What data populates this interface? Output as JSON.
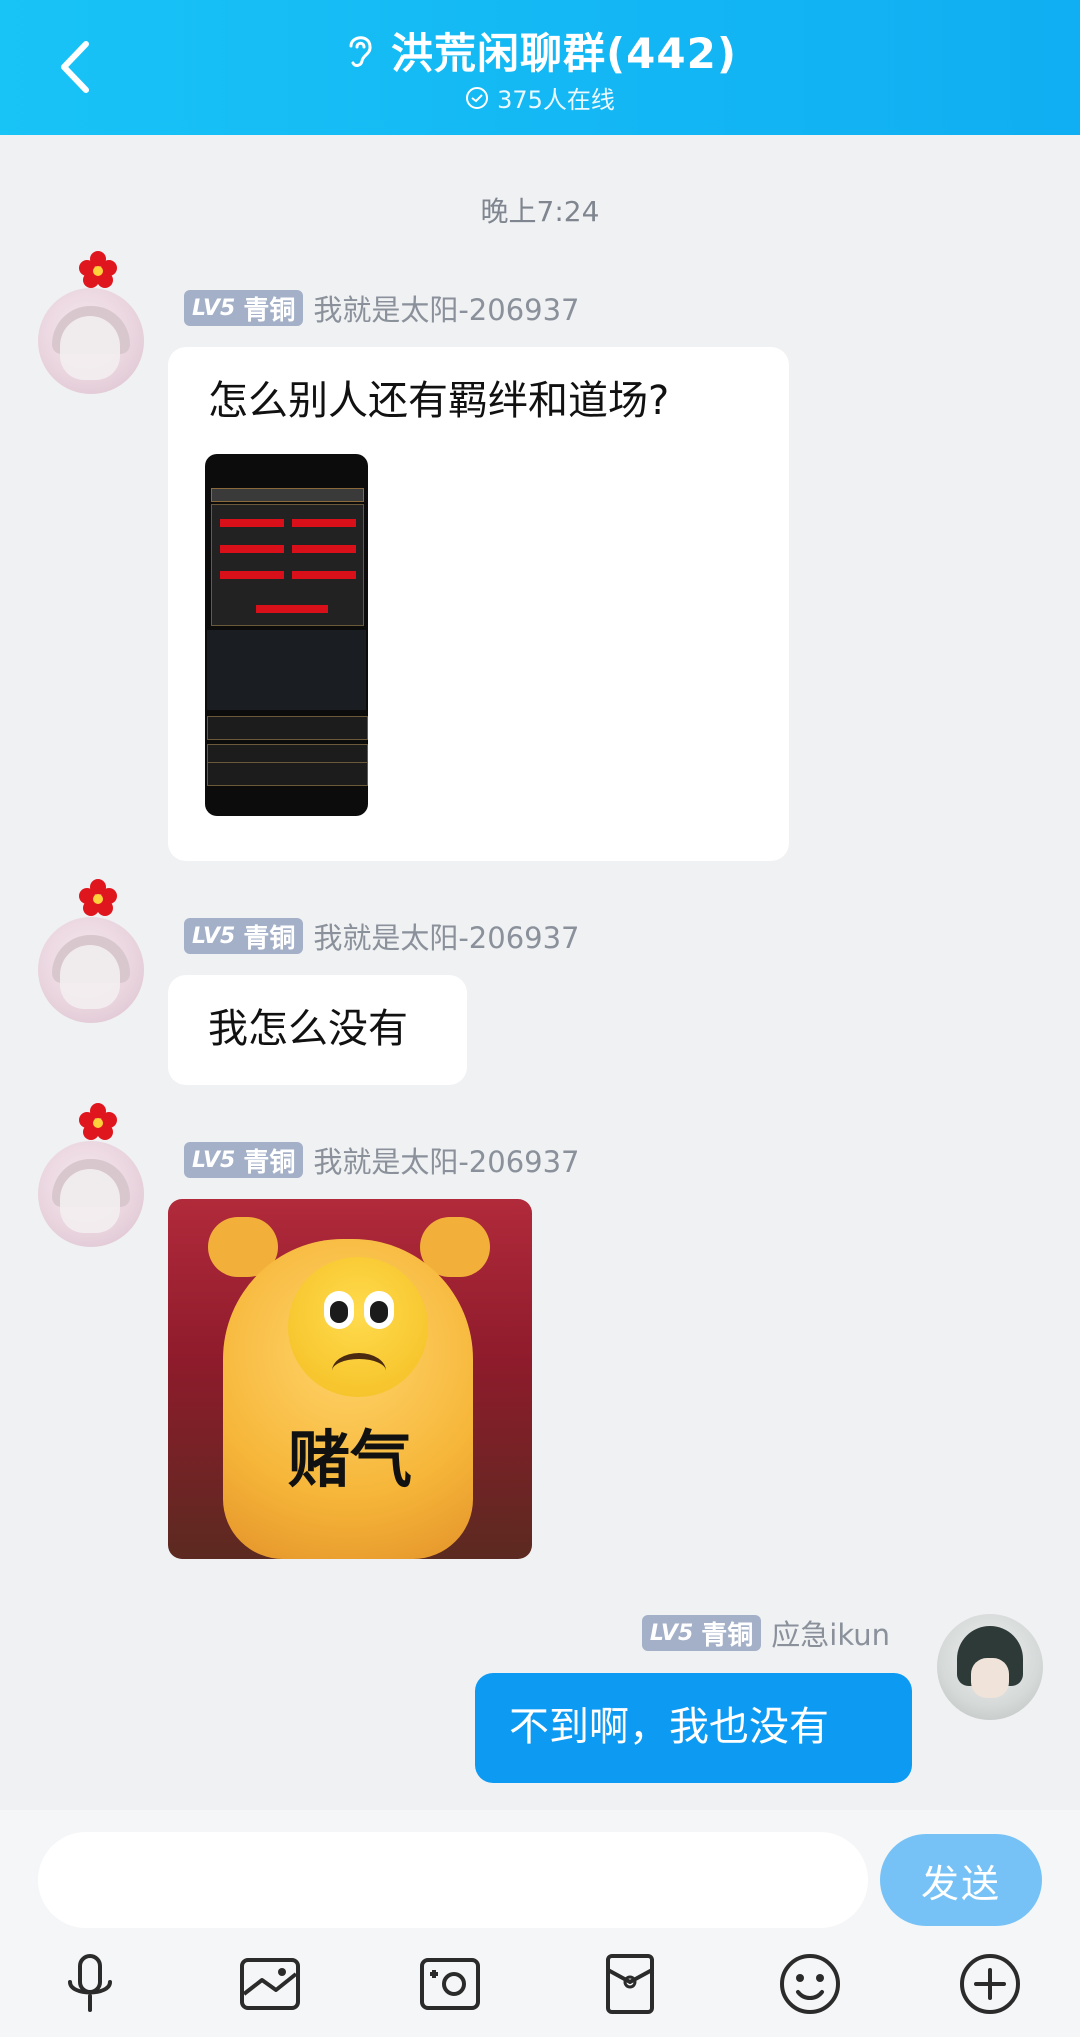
{
  "header": {
    "title": "洪荒闲聊群(442)",
    "online": "375人在线"
  },
  "timestamp": "晚上7:24",
  "messages": [
    {
      "badge_lv": "LV5",
      "badge_rank": "青铜",
      "sender": "我就是太阳-206937",
      "text": "怎么别人还有羁绊和道场?"
    },
    {
      "badge_lv": "LV5",
      "badge_rank": "青铜",
      "sender": "我就是太阳-206937",
      "text": "我怎么没有"
    },
    {
      "badge_lv": "LV5",
      "badge_rank": "青铜",
      "sender": "我就是太阳-206937",
      "sticker_text": "赌气"
    },
    {
      "badge_lv": "LV5",
      "badge_rank": "青铜",
      "sender": "应急ikun",
      "text": "不到啊，我也没有"
    }
  ],
  "input": {
    "value": "",
    "send_label": "发送"
  },
  "toolbar": [
    "voice-icon",
    "image-icon",
    "camera-icon",
    "red-packet-icon",
    "emoji-icon",
    "plus-icon"
  ],
  "colors": {
    "header": "#14b8f4",
    "mine_bubble": "#0d9af3",
    "badge": "#a3b0c8",
    "send_button": "#76c2f7"
  }
}
